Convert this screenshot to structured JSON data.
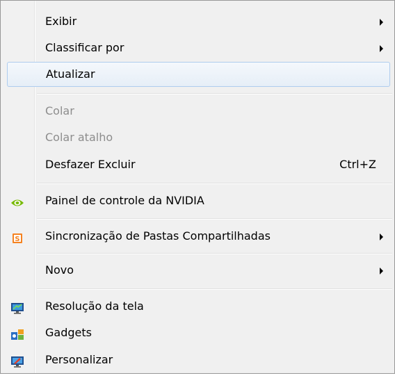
{
  "menu": {
    "items": [
      {
        "label": "Exibir",
        "has_submenu": true
      },
      {
        "label": "Classificar por",
        "has_submenu": true
      },
      {
        "label": "Atualizar",
        "state": "hover"
      },
      {
        "label": "Colar",
        "state": "disabled"
      },
      {
        "label": "Colar atalho",
        "state": "disabled"
      },
      {
        "label": "Desfazer Excluir",
        "shortcut": "Ctrl+Z"
      },
      {
        "label": "Painel de controle da NVIDIA",
        "icon": "nvidia-icon"
      },
      {
        "label": "Sincronização de Pastas Compartilhadas",
        "icon": "sync-folders-icon",
        "has_submenu": true
      },
      {
        "label": "Novo",
        "has_submenu": true
      },
      {
        "label": "Resolução da tela",
        "icon": "screen-resolution-icon"
      },
      {
        "label": "Gadgets",
        "icon": "gadgets-icon"
      },
      {
        "label": "Personalizar",
        "icon": "personalize-icon"
      }
    ]
  },
  "colors": {
    "menu_background": "#f0f0f0",
    "border": "#979797",
    "hover_border": "#aeccee",
    "disabled_text": "#8d8d8d",
    "nvidia_green": "#76b900",
    "sync_orange": "#f58220"
  }
}
